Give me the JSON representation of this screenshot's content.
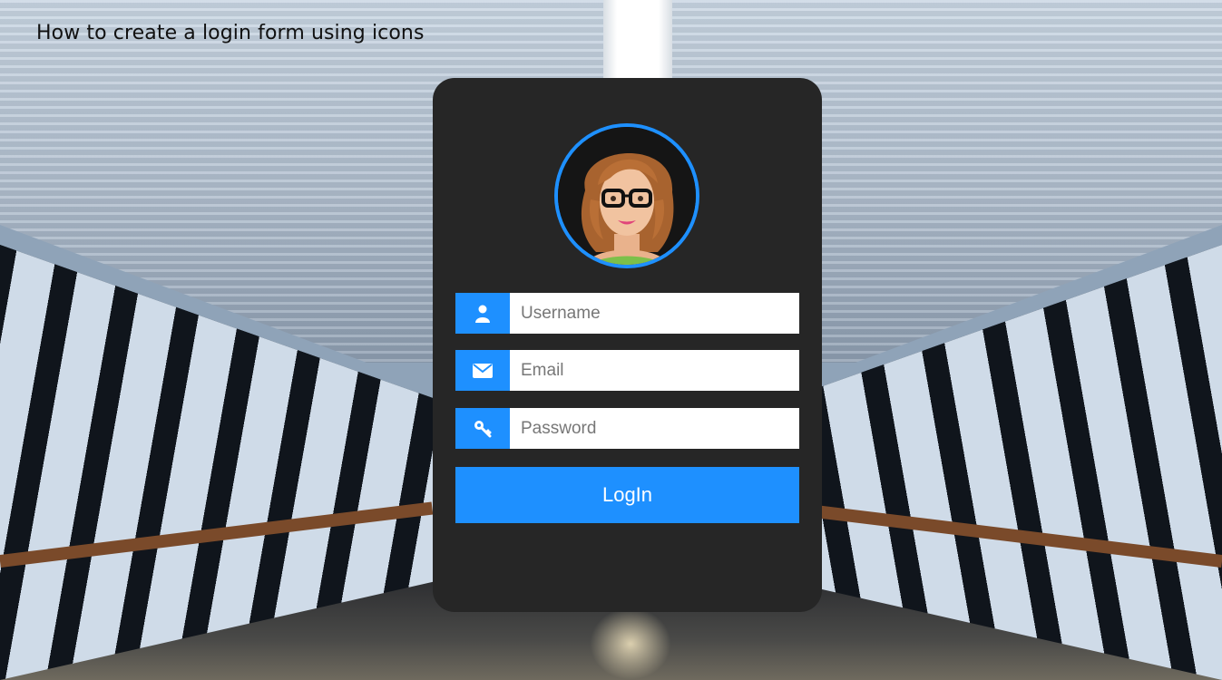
{
  "page": {
    "title": "How to create a login form using icons"
  },
  "form": {
    "avatar_alt": "user avatar",
    "fields": [
      {
        "icon": "user-icon",
        "placeholder": "Username",
        "value": ""
      },
      {
        "icon": "envelope-icon",
        "placeholder": "Email",
        "value": ""
      },
      {
        "icon": "key-icon",
        "placeholder": "Password",
        "value": ""
      }
    ],
    "login_label": "LogIn"
  },
  "colors": {
    "card_background": "#262626",
    "accent": "#1e90ff",
    "input_background": "#ffffff"
  }
}
